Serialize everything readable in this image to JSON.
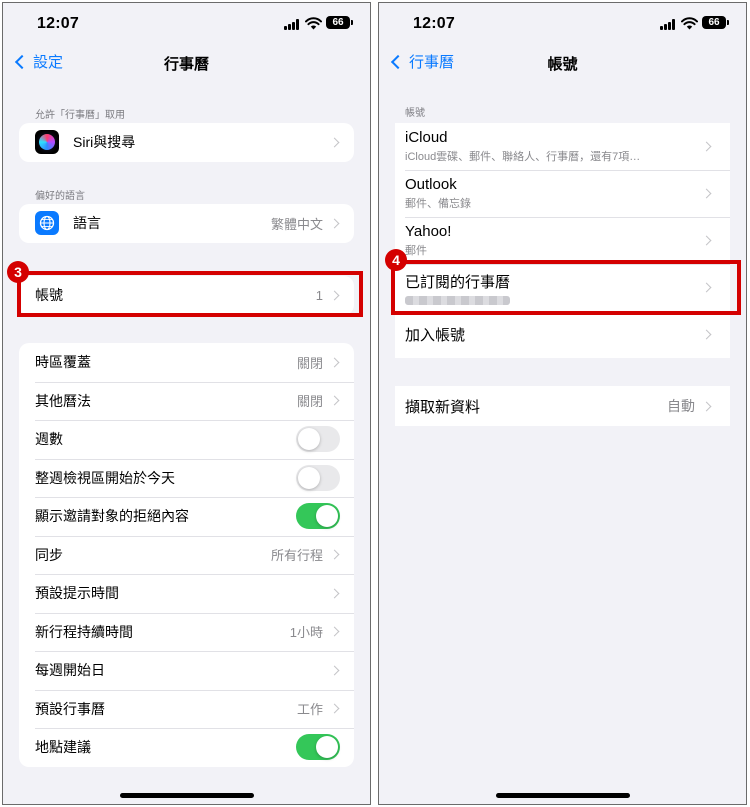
{
  "colors": {
    "accent": "#0a7aff",
    "highlight": "#d40000",
    "toggle_on": "#34c759",
    "background": "#f2f2f7"
  },
  "left": {
    "status": {
      "time": "12:07",
      "battery": "66"
    },
    "nav": {
      "back_label": "設定",
      "title": "行事曆"
    },
    "sections": {
      "allow_label": "允許「行事曆」取用",
      "siri_label": "Siri與搜尋",
      "language_section": "偏好的語言",
      "language_label": "語言",
      "language_value": "繁體中文",
      "accounts_label": "帳號",
      "accounts_value": "1"
    },
    "settings": [
      {
        "label": "時區覆蓋",
        "value": "關閉"
      },
      {
        "label": "其他曆法",
        "value": "關閉"
      },
      {
        "label": "週數",
        "toggle": "off"
      },
      {
        "label": "整週檢視區開始於今天",
        "toggle": "off"
      },
      {
        "label": "顯示邀請對象的拒絕內容",
        "toggle": "on"
      },
      {
        "label": "同步",
        "value": "所有行程"
      },
      {
        "label": "預設提示時間",
        "value": ""
      },
      {
        "label": "新行程持續時間",
        "value": "1小時"
      },
      {
        "label": "每週開始日",
        "value": ""
      },
      {
        "label": "預設行事曆",
        "value": "工作"
      },
      {
        "label": "地點建議",
        "toggle": "on"
      }
    ],
    "marker": "3"
  },
  "right": {
    "status": {
      "time": "12:07",
      "battery": "66"
    },
    "nav": {
      "back_label": "行事曆",
      "title": "帳號"
    },
    "section_label": "帳號",
    "accounts": [
      {
        "name": "iCloud",
        "sub": "iCloud雲碟、郵件、聯絡人、行事曆，還有7項…"
      },
      {
        "name": "Outlook",
        "sub": "郵件、備忘錄"
      },
      {
        "name": "Yahoo!",
        "sub": "郵件"
      },
      {
        "name": "已訂閱的行事曆",
        "sub": ""
      },
      {
        "name": "加入帳號",
        "sub": ""
      }
    ],
    "fetch": {
      "label": "擷取新資料",
      "value": "自動"
    },
    "marker": "4"
  }
}
